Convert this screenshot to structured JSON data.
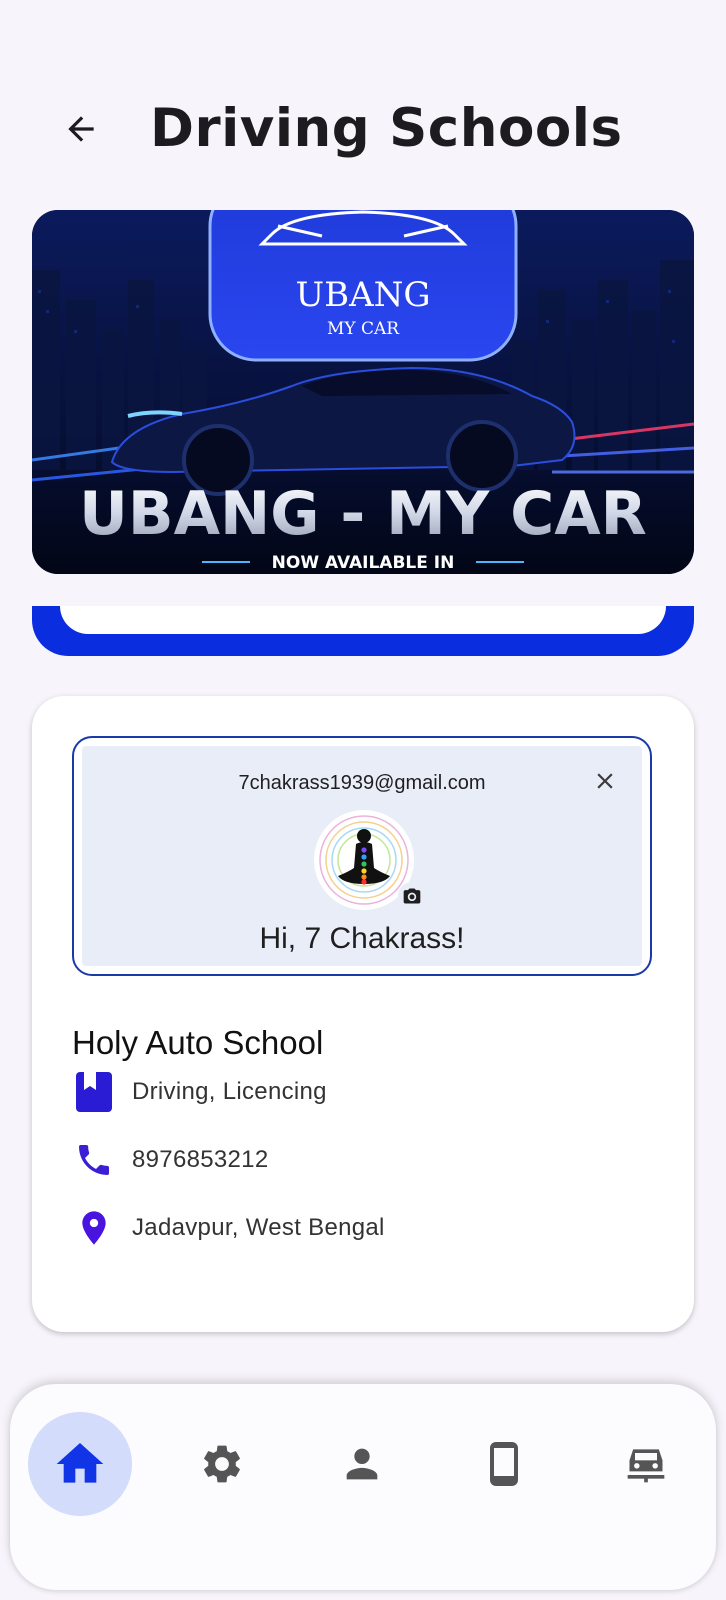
{
  "header": {
    "title": "Driving Schools",
    "back_icon": "arrow-back-icon"
  },
  "banner": {
    "logo_line1": "UBANG",
    "logo_line2": "MY CAR",
    "headline": "UBANG - MY CAR",
    "subline": "NOW AVAILABLE IN"
  },
  "account_chip": {
    "email": "7chakrass1939@gmail.com",
    "greeting": "Hi, 7 Chakrass!",
    "close_icon": "close-icon",
    "camera_icon": "camera-icon"
  },
  "school": {
    "name": "Holy Auto School",
    "services": "Driving, Licencing",
    "phone": "8976853212",
    "location": "Jadavpur, West Bengal"
  },
  "bottom_nav": {
    "items": [
      {
        "icon": "home-icon",
        "active": true
      },
      {
        "icon": "gear-icon",
        "active": false
      },
      {
        "icon": "person-icon",
        "active": false
      },
      {
        "icon": "phone-device-icon",
        "active": false
      },
      {
        "icon": "car-icon",
        "active": false
      }
    ]
  },
  "colors": {
    "accent": "#0a2de0",
    "icon_purple": "#3a1fd6",
    "nav_active_bg": "#d3dcfb"
  }
}
